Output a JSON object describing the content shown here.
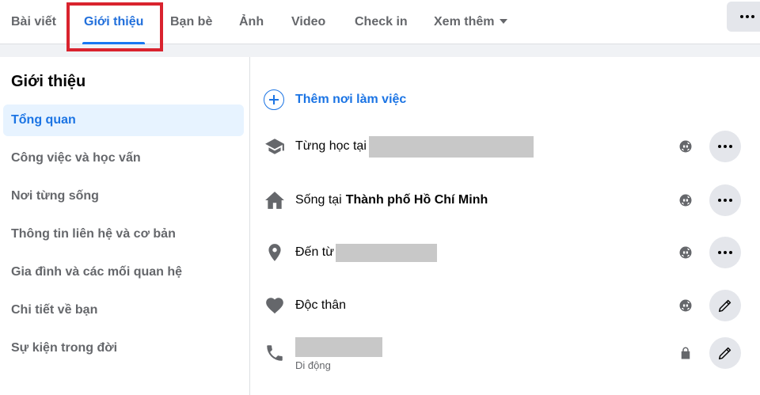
{
  "tabs": [
    {
      "label": "Bài viết"
    },
    {
      "label": "Giới thiệu"
    },
    {
      "label": "Bạn bè"
    },
    {
      "label": "Ảnh"
    },
    {
      "label": "Video"
    },
    {
      "label": "Check in"
    },
    {
      "label": "Xem thêm"
    }
  ],
  "active_tab": "Giới thiệu",
  "sidebar": {
    "title": "Giới thiệu",
    "items": [
      {
        "label": "Tổng quan"
      },
      {
        "label": "Công việc và học vấn"
      },
      {
        "label": "Nơi từng sống"
      },
      {
        "label": "Thông tin liên hệ và cơ bản"
      },
      {
        "label": "Gia đình và các mối quan hệ"
      },
      {
        "label": "Chi tiết về bạn"
      },
      {
        "label": "Sự kiện trong đời"
      }
    ]
  },
  "overview": {
    "add_work_label": "Thêm nơi làm việc",
    "studied_prefix": "Từng học tại",
    "lives_prefix": "Sống tại",
    "lives_value": "Thành phố Hồ Chí Minh",
    "from_prefix": "Đến từ",
    "relationship": "Độc thân",
    "phone_sublabel": "Di động"
  },
  "colors": {
    "accent": "#1b74e4",
    "highlight_box": "#d9232e",
    "redaction": "#c8c8c8"
  },
  "icons": {
    "education": "graduation-cap-icon",
    "home": "home-icon",
    "location": "map-pin-icon",
    "relationship": "heart-icon",
    "phone": "phone-icon",
    "privacy_public": "globe-icon",
    "privacy_private": "lock-icon",
    "more": "more-dots-icon",
    "edit": "pencil-icon",
    "add": "plus-circle-icon"
  }
}
